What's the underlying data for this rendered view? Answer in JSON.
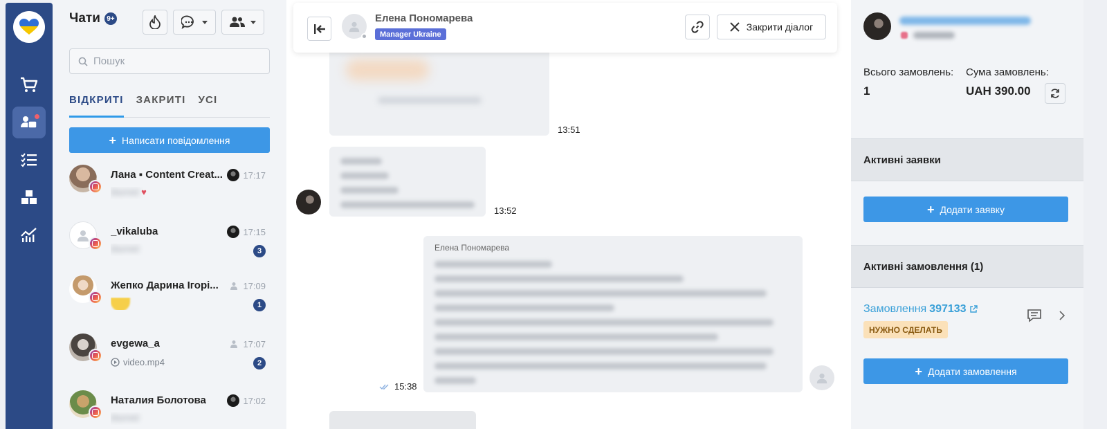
{
  "chats_panel": {
    "title": "Чати",
    "unread_badge": "9+",
    "search_placeholder": "Пошук",
    "tabs": [
      "ВІДКРИТІ",
      "ЗАКРИТІ",
      "УСІ"
    ],
    "compose_label": "Написати повідомлення",
    "items": [
      {
        "name": "Лана ▪ Content Creat...",
        "time": "17:17",
        "preview": "blurred",
        "unread": ""
      },
      {
        "name": "_vikaluba",
        "time": "17:15",
        "preview": "blurred",
        "unread": "3"
      },
      {
        "name": "Жепко Дарина Ігорі...",
        "time": "17:09",
        "preview": "blurred",
        "unread": "1"
      },
      {
        "name": "evgewa_a",
        "time": "17:07",
        "preview": "video.mp4",
        "unread": "2"
      },
      {
        "name": "Наталия Болотова",
        "time": "17:02",
        "preview": "blurred",
        "unread": ""
      }
    ]
  },
  "conversation": {
    "contact_name": "Елена Пономарева",
    "contact_role": "Manager Ukraine",
    "close_label": "Закрити діалог",
    "messages": [
      {
        "time": "13:51"
      },
      {
        "time": "13:52"
      },
      {
        "sender": "Елена Пономарева",
        "time": "15:38"
      }
    ]
  },
  "side_panel": {
    "total_orders_label": "Всього замовлень:",
    "total_orders_value": "1",
    "orders_sum_label": "Сума замовлень:",
    "orders_sum_value": "UAH 390.00",
    "active_requests_title": "Активні заявки",
    "add_request_label": "Додати заявку",
    "active_orders_title": "Активні замовлення (1)",
    "order_prefix": "Замовлення",
    "order_number": "397133",
    "order_status": "НУЖНО СДЕЛАТЬ",
    "add_order_label": "Додати замовлення"
  },
  "colors": {
    "rail": "#2c4a86",
    "accent_button": "#3d97e6",
    "role_tag": "#5b6fd8",
    "order_status_bg": "#fbe1b9"
  }
}
